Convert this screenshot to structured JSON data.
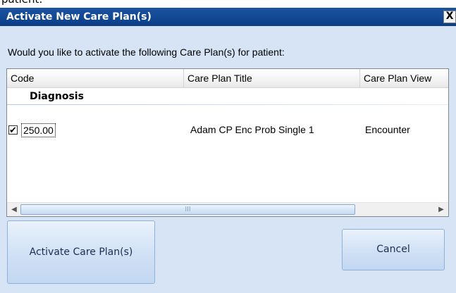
{
  "stray_text": "patient:",
  "dialog": {
    "title": "Activate New Care Plan(s)",
    "close_label": "X",
    "prompt": "Would you like to activate the following Care Plan(s) for patient:"
  },
  "table": {
    "columns": [
      "Code",
      "Care Plan Title",
      "Care Plan View"
    ],
    "group": "Diagnosis",
    "rows": [
      {
        "checked": true,
        "check_glyph": "✔",
        "code": "250.00",
        "title": "Adam CP Enc Prob Single 1",
        "view": "Encounter"
      }
    ],
    "scrollbar": {
      "left_arrow": "◀",
      "right_arrow": "▶",
      "thumb_grip": "III"
    }
  },
  "buttons": {
    "activate": "Activate Care Plan(s)",
    "cancel": "Cancel"
  },
  "colors": {
    "titlebar": "#0c3d86",
    "dialog_bg": "#d6e4f5",
    "button_bg": "#d2e2f6"
  }
}
